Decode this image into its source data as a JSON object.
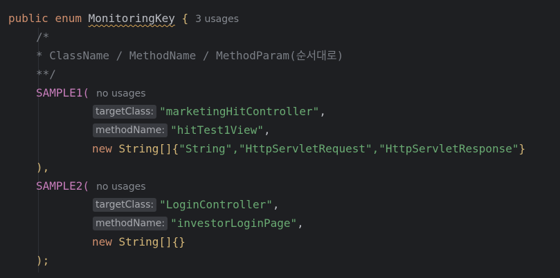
{
  "code": {
    "line1": {
      "kw_public": "public",
      "kw_enum": "enum",
      "enum_name": "MonitoringKey",
      "open_brace": "{",
      "usages": "3 usages"
    },
    "comment": {
      "open": "/*",
      "body_star": "*",
      "body_text": "ClassName / MethodName / MethodParam(순서대로)",
      "close": "**/"
    },
    "sample1": {
      "name": "SAMPLE1(",
      "usages": "no usages",
      "target_class_hint": "targetClass:",
      "target_class_value": "\"marketingHitController\"",
      "method_name_hint": "methodName:",
      "method_name_value": "\"hitTest1View\"",
      "new_kw": "new",
      "array_type": "String[]",
      "array_open": "{",
      "params": "\"String\",\"HttpServletRequest\",\"HttpServletResponse\"",
      "array_close": "}",
      "close": "),"
    },
    "sample2": {
      "name": "SAMPLE2(",
      "usages": "no usages",
      "target_class_hint": "targetClass:",
      "target_class_value": "\"LoginController\"",
      "method_name_hint": "methodName:",
      "method_name_value": "\"investorLoginPage\"",
      "new_kw": "new",
      "array_type": "String[]",
      "array_empty": "{}",
      "close": ");"
    },
    "comma": ","
  }
}
